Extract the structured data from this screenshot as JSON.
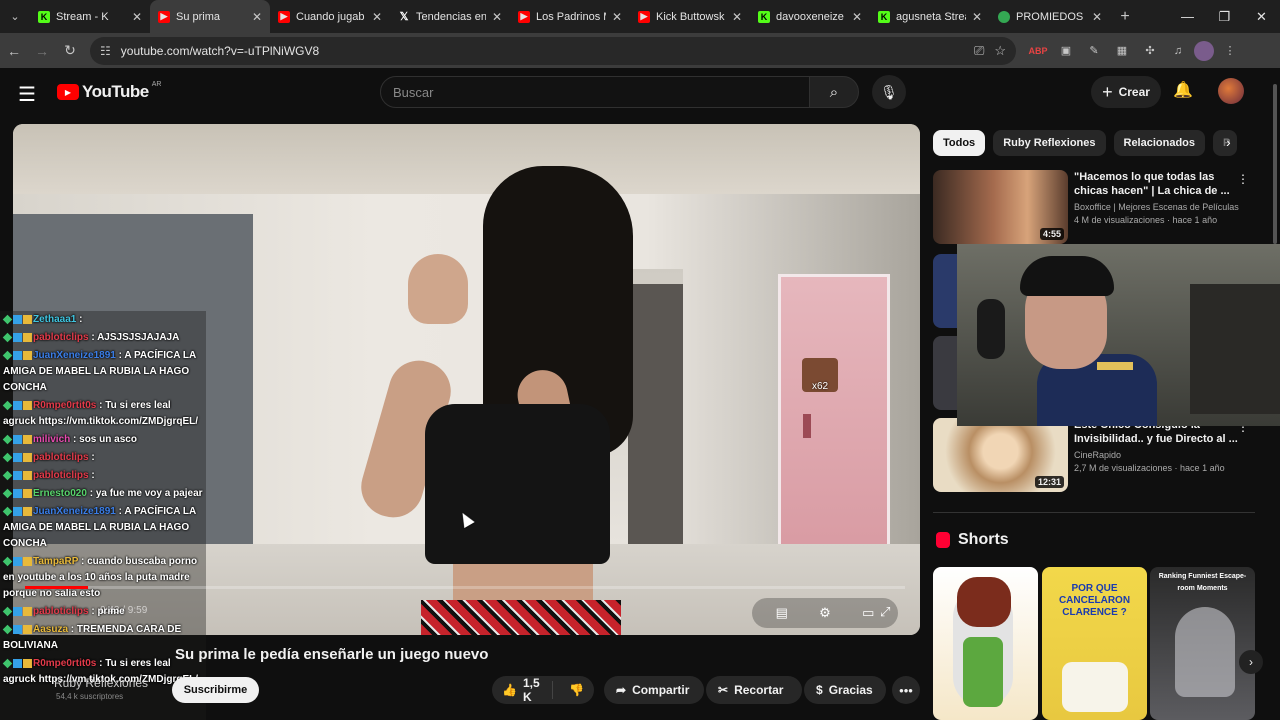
{
  "browser": {
    "tabs": [
      {
        "title": "Stream - K",
        "icon": "kick",
        "active": false
      },
      {
        "title": "Su prima ",
        "icon": "youtube",
        "active": true
      },
      {
        "title": "Cuando jugab",
        "icon": "youtube",
        "active": false
      },
      {
        "title": "Tendencias en",
        "icon": "x",
        "active": false
      },
      {
        "title": "Los Padrinos M",
        "icon": "youtube",
        "active": false
      },
      {
        "title": "Kick Buttowsk",
        "icon": "youtube",
        "active": false
      },
      {
        "title": "davooxeneize",
        "icon": "kick",
        "active": false
      },
      {
        "title": "agusneta Strea",
        "icon": "kick",
        "active": false
      },
      {
        "title": "PROMIEDOS -",
        "icon": "chrome",
        "active": false
      }
    ],
    "url": "youtube.com/watch?v=-uTPlNiWGV8"
  },
  "youtube": {
    "logo_text": "YouTube",
    "country": "AR",
    "search_placeholder": "Buscar",
    "create_label": "Crear"
  },
  "video": {
    "title": "Su prima le pedía enseñarle un juego nuevo",
    "time": "0:43 / 9:59",
    "progress_fraction": 0.072,
    "channel": "Ruby Reflexiones",
    "subscribers": "54,4 k suscriptores",
    "subscribe_label": "Suscribirme",
    "likes": "1,5 K",
    "share_label": "Compartir",
    "clip_label": "Recortar",
    "thanks_label": "Gracias",
    "emote_count": "x62"
  },
  "chat": [
    {
      "user": "Zethaaa1",
      "text": "",
      "color": "#3fc5e0"
    },
    {
      "user": "pabloticlips",
      "text": "AJSJSJSJAJAJA",
      "color": "#e23a4a"
    },
    {
      "user": "JuanXeneize1891",
      "text": "A PACÍFICA LA AMIGA DE MABEL LA RUBIA LA HAGO CONCHA",
      "color": "#3a7ee8"
    },
    {
      "user": "R0mpe0rtit0s",
      "text": "Tu si eres leal agruck https://vm.tiktok.com/ZMDjgrqEL/",
      "color": "#e23a4a"
    },
    {
      "user": "milivich",
      "text": "sos un asco",
      "color": "#e84bb0"
    },
    {
      "user": "pabloticlips",
      "text": "",
      "color": "#e23a4a"
    },
    {
      "user": "pabloticlips",
      "text": "",
      "color": "#e23a4a"
    },
    {
      "user": "Ernesto020",
      "text": "ya fue me voy a pajear",
      "color": "#57d36b"
    },
    {
      "user": "JuanXeneize1891",
      "text": "A PACÍFICA LA AMIGA DE MABEL LA RUBIA LA HAGO CONCHA",
      "color": "#3a7ee8"
    },
    {
      "user": "TampaRP",
      "text": "cuando buscaba porno en youtube a los 10 años la puta madre porque no salia esto",
      "color": "#e8b93a"
    },
    {
      "user": "pabloticlips",
      "text": "prime",
      "color": "#e23a4a"
    },
    {
      "user": "Aasuza",
      "text": "TREMENDA CARA DE BOLIVIANA",
      "color": "#e8b93a"
    },
    {
      "user": "R0mpe0rtit0s",
      "text": "Tu si eres leal agruck https://vm.tiktok.com/ZMDjgrqEL/",
      "color": "#e23a4a"
    }
  ],
  "sidebar": {
    "chips": [
      "Todos",
      "Ruby Reflexiones",
      "Relacionados",
      "P"
    ],
    "recommendations": [
      {
        "title": "\"Hacemos lo que todas las chicas hacen\" | La chica de ...",
        "channel": "Boxoffice | Mejores Escenas de Películas",
        "meta": "4 M de visualizaciones · hace 1 año",
        "duration": "4:55"
      },
      {
        "title": "Este Chico Consiguió la Invisibilidad.. y fue Directo al ...",
        "channel": "CineRapido",
        "meta": "2,7 M de visualizaciones · hace 1 año",
        "duration": "12:31"
      }
    ],
    "shorts_heading": "Shorts",
    "shorts": [
      {
        "text": ""
      },
      {
        "text": "POR QUE CANCELARON CLARENCE ?"
      },
      {
        "text": "Ranking Funniest Escape-room Moments"
      }
    ]
  }
}
